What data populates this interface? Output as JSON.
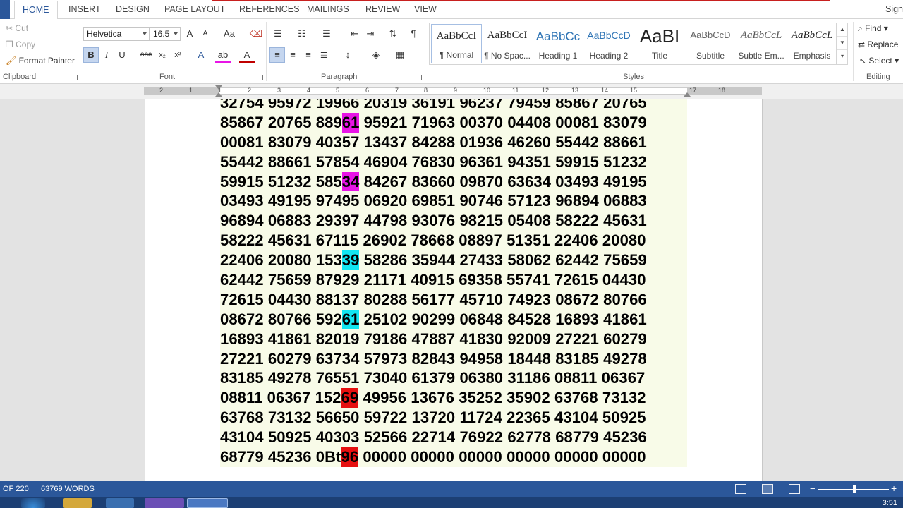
{
  "tabs": [
    "HOME",
    "INSERT",
    "DESIGN",
    "PAGE LAYOUT",
    "REFERENCES",
    "MAILINGS",
    "REVIEW",
    "VIEW"
  ],
  "account_label": "Sign",
  "clipboard": {
    "cut": "Cut",
    "copy": "Copy",
    "format_painter": "Format Painter",
    "group_label": "Clipboard"
  },
  "font": {
    "family": "Helvetica",
    "size": "16.5",
    "group_label": "Font",
    "case_button": "Aa",
    "grow": "A",
    "shrink": "A"
  },
  "paragraph": {
    "group_label": "Paragraph"
  },
  "styles": {
    "group_label": "Styles",
    "items": [
      {
        "sample": "AaBbCcI",
        "name": "¶ Normal"
      },
      {
        "sample": "AaBbCcI",
        "name": "¶ No Spac..."
      },
      {
        "sample": "AaBbCc",
        "name": "Heading 1"
      },
      {
        "sample": "AaBbCcD",
        "name": "Heading 2"
      },
      {
        "sample": "AaBI",
        "name": "Title"
      },
      {
        "sample": "AaBbCcD",
        "name": "Subtitle"
      },
      {
        "sample": "AaBbCcL",
        "name": "Subtle Em..."
      },
      {
        "sample": "AaBbCcL",
        "name": "Emphasis"
      }
    ]
  },
  "editing": {
    "find": "Find",
    "replace": "Replace",
    "select": "Select",
    "group_label": "Editing"
  },
  "ruler_numbers": [
    "2",
    "1",
    "1",
    "2",
    "3",
    "4",
    "5",
    "6",
    "7",
    "8",
    "9",
    "10",
    "11",
    "12",
    "13",
    "14",
    "15",
    "",
    "17",
    "18"
  ],
  "document_lines": [
    [
      "32754 95972 19966 20319 36191 96237 79459 85867 20765"
    ],
    [
      "85867 20765 889",
      {
        "t": "61",
        "c": "magenta"
      },
      " 95921 71963 00370 04408 00081 83079"
    ],
    [
      "00081 83079 40357 13437 84288 01936 46260 55442 88661"
    ],
    [
      "55442 88661 57854 46904 76830 96361 94351 59915 51232"
    ],
    [
      "59915 51232 585",
      {
        "t": "34",
        "c": "magenta"
      },
      " 84267 83660 09870 63634 03493 49195"
    ],
    [
      "03493 49195 97495 06920 69851 90746 57123 96894 06883"
    ],
    [
      "96894 06883 29397 44798 93076 98215 05408 58222 45631"
    ],
    [
      "58222 45631 67115 26902 78668 08897 51351 22406 20080"
    ],
    [
      "22406 20080 153",
      {
        "t": "39",
        "c": "cyan"
      },
      " 58286 35944 27433 58062 62442 75659"
    ],
    [
      "62442 75659 87929 21171 40915 69358 55741 72615 04430"
    ],
    [
      "72615 04430 88137 80288 56177 45710 74923 08672 80766"
    ],
    [
      "08672 80766 592",
      {
        "t": "61",
        "c": "cyan"
      },
      " 25102 90299 06848 84528 16893 41861"
    ],
    [
      "16893 41861 82019 79186 47887 41830 92009 27221 60279"
    ],
    [
      "27221 60279 63734 57973 82843 94958 18448 83185 49278"
    ],
    [
      "83185 49278 76551 73040 61379 06380 31186 08811 06367"
    ],
    [
      "08811 06367 152",
      {
        "t": "69",
        "c": "red"
      },
      " 49956 13676 35252 35902 63768 73132"
    ],
    [
      "63768 73132 56650 59722 13720 11724 22365 43104 50925"
    ],
    [
      "43104 50925 40303 52566 22714 76922 62778 68779 45236"
    ],
    [
      "68779 45236 0Bt",
      {
        "t": "96",
        "c": "red"
      },
      " 00000 00000 00000 00000 00000 00000"
    ]
  ],
  "status": {
    "page": "OF 220",
    "words": "63769 WORDS"
  },
  "clock": "3:51"
}
